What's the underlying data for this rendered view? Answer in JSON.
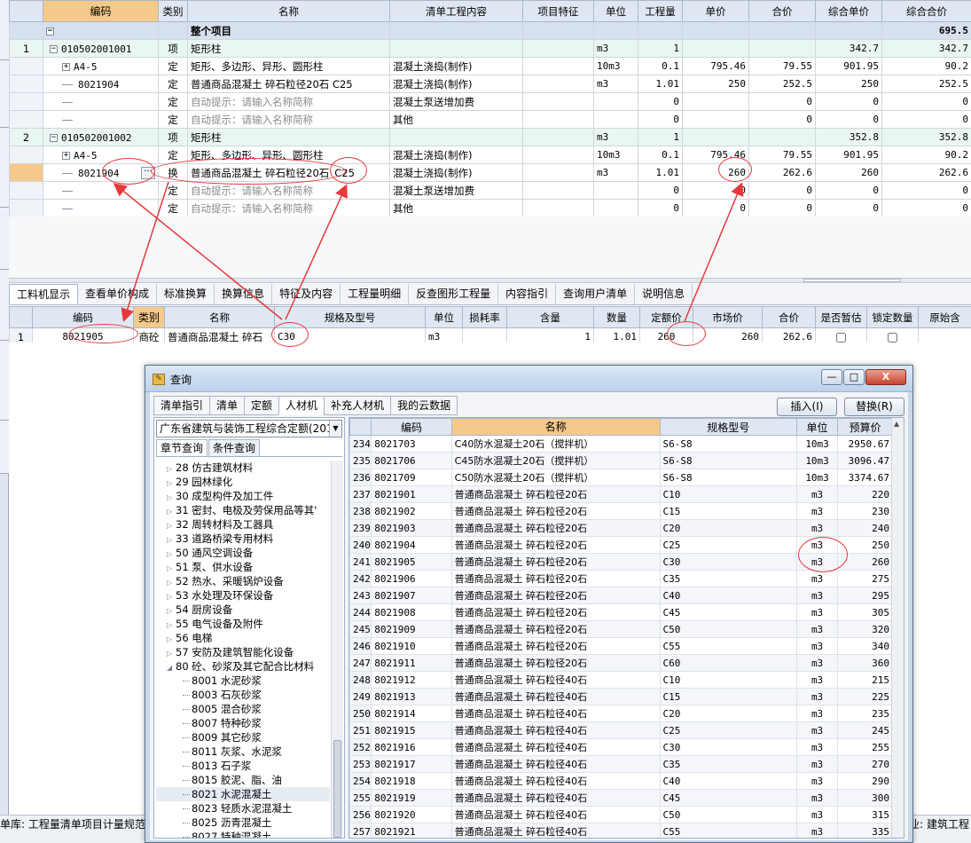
{
  "top_table": {
    "headers": [
      "",
      "编码",
      "类别",
      "名称",
      "清单工程内容",
      "项目特征",
      "单位",
      "工程量",
      "单价",
      "合价",
      "综合单价",
      "综合合价"
    ],
    "project_row": {
      "toggle": "−",
      "name": "整个项目",
      "total": "695.5"
    },
    "rows": [
      {
        "rn": "1",
        "level": "list",
        "toggle": "−",
        "code": "010502001001",
        "type": "项",
        "name": "矩形柱",
        "content": "",
        "feature": "",
        "unit": "m3",
        "qty": "1",
        "price": "",
        "amount": "",
        "comp_price": "342.7",
        "comp_amount": "342.7"
      },
      {
        "rn": "",
        "level": "quota",
        "toggle": "+",
        "code": "A4-5",
        "type": "定",
        "name": "矩形、多边形、异形、圆形柱",
        "content": "混凝土浇捣(制作)",
        "feature": "",
        "unit": "10m3",
        "qty": "0.1",
        "price": "795.46",
        "amount": "79.55",
        "comp_price": "901.95",
        "comp_amount": "90.2"
      },
      {
        "rn": "",
        "level": "item",
        "toggle": "",
        "code": "8021904",
        "type": "定",
        "name": "普通商品混凝土 碎石粒径20石 C25",
        "content": "混凝土浇捣(制作)",
        "feature": "",
        "unit": "m3",
        "qty": "1.01",
        "price": "250",
        "amount": "252.5",
        "comp_price": "250",
        "comp_amount": "252.5"
      },
      {
        "rn": "",
        "level": "item",
        "toggle": "",
        "code": "",
        "type": "定",
        "name": "自动提示：请输入名称简称",
        "content": "混凝土泵送增加费",
        "feature": "",
        "unit": "",
        "qty": "",
        "price": "",
        "amount": "0",
        "comp_price": "0",
        "comp_amount": "0",
        "qty_zero": "0",
        "gray": true
      },
      {
        "rn": "",
        "level": "item",
        "toggle": "",
        "code": "",
        "type": "定",
        "name": "自动提示：请输入名称简称",
        "content": "其他",
        "feature": "",
        "unit": "",
        "qty": "",
        "price": "",
        "amount": "0",
        "comp_price": "0",
        "comp_amount": "0",
        "qty_zero": "0",
        "gray": true
      },
      {
        "rn": "2",
        "level": "list",
        "toggle": "−",
        "code": "010502001002",
        "type": "项",
        "name": "矩形柱",
        "content": "",
        "feature": "",
        "unit": "m3",
        "qty": "1",
        "price": "",
        "amount": "",
        "comp_price": "352.8",
        "comp_amount": "352.8"
      },
      {
        "rn": "",
        "level": "quota",
        "toggle": "+",
        "code": "A4-5",
        "type": "定",
        "name": "矩形、多边形、异形、圆形柱",
        "content": "混凝土浇捣(制作)",
        "feature": "",
        "unit": "10m3",
        "qty": "0.1",
        "price": "795.46",
        "amount": "79.55",
        "comp_price": "901.95",
        "comp_amount": "90.2"
      },
      {
        "rn": "",
        "level": "cur",
        "toggle": "",
        "code": "8021904",
        "type": "换",
        "name": "普通商品混凝土 碎石粒径20石",
        "name_tail": "C25",
        "content": "混凝土浇捣(制作)",
        "feature": "",
        "unit": "m3",
        "qty": "1.01",
        "price": "260",
        "amount": "262.6",
        "comp_price": "260",
        "comp_amount": "262.6",
        "dots": "···"
      },
      {
        "rn": "",
        "level": "item",
        "toggle": "",
        "code": "",
        "type": "定",
        "name": "自动提示：请输入名称简称",
        "content": "混凝土泵送增加费",
        "feature": "",
        "unit": "",
        "qty": "",
        "price": "0",
        "amount": "0",
        "comp_price": "0",
        "comp_amount": "0",
        "qty_zero": "0",
        "gray": true
      },
      {
        "rn": "",
        "level": "item",
        "toggle": "",
        "code": "",
        "type": "定",
        "name": "自动提示：请输入名称简称",
        "content": "其他",
        "feature": "",
        "unit": "",
        "qty": "",
        "price": "0",
        "amount": "0",
        "comp_price": "0",
        "comp_amount": "0",
        "qty_zero": "0",
        "gray": true
      }
    ]
  },
  "mid_tabs": [
    "工料机显示",
    "查看单价构成",
    "标准换算",
    "换算信息",
    "特征及内容",
    "工程量明细",
    "反查图形工程量",
    "内容指引",
    "查询用户清单",
    "说明信息"
  ],
  "mid_table": {
    "headers": [
      "",
      "编码",
      "类别",
      "名称",
      "规格及型号",
      "单位",
      "损耗率",
      "含量",
      "数量",
      "定额价",
      "市场价",
      "合价",
      "是否暂估",
      "锁定数量",
      "原始含"
    ],
    "row": {
      "rn": "1",
      "code": "8021905",
      "type": "商砼",
      "name": "普通商品混凝土 碎石",
      "spec": "C30",
      "unit": "m3",
      "loss": "",
      "content": "1",
      "qty": "1.01",
      "quota_price": "260",
      "market_price": "260",
      "amount": "262.6"
    }
  },
  "dialog": {
    "title": "查询",
    "window_buttons": {
      "minimize": "—",
      "restore": "□",
      "close": "X"
    },
    "tabs": [
      "清单指引",
      "清单",
      "定额",
      "人材机",
      "补充人材机",
      "我的云数据"
    ],
    "active_tab": "人材机",
    "insert_label": "插入(I)",
    "replace_label": "替换(R)",
    "library": "广东省建筑与装饰工程综合定额(201",
    "subtabs": [
      "章节查询",
      "条件查询"
    ],
    "tree": [
      {
        "arrow": "▷",
        "label": "28 仿古建筑材料",
        "indent": 1
      },
      {
        "arrow": "▷",
        "label": "29 园林绿化",
        "indent": 1
      },
      {
        "arrow": "▷",
        "label": "30 成型构件及加工件",
        "indent": 1
      },
      {
        "arrow": "▷",
        "label": "31 密封、电极及劳保用品等其'",
        "indent": 1
      },
      {
        "arrow": "▷",
        "label": "32 周转材料及工器具",
        "indent": 1
      },
      {
        "arrow": "▷",
        "label": "33 道路桥梁专用材料",
        "indent": 1
      },
      {
        "arrow": "▷",
        "label": "50 通风空调设备",
        "indent": 1
      },
      {
        "arrow": "▷",
        "label": "51 泵、供水设备",
        "indent": 1
      },
      {
        "arrow": "▷",
        "label": "52 热水、采暖锅炉设备",
        "indent": 1
      },
      {
        "arrow": "▷",
        "label": "53 水处理及环保设备",
        "indent": 1
      },
      {
        "arrow": "▷",
        "label": "54 厨房设备",
        "indent": 1
      },
      {
        "arrow": "▷",
        "label": "55 电气设备及附件",
        "indent": 1
      },
      {
        "arrow": "▷",
        "label": "56 电梯",
        "indent": 1
      },
      {
        "arrow": "▷",
        "label": "57 安防及建筑智能化设备",
        "indent": 1
      },
      {
        "arrow": "◢",
        "label": "80 砼、砂浆及其它配合比材料",
        "indent": 1
      },
      {
        "arrow": "",
        "label": "8001 水泥砂浆",
        "indent": 2
      },
      {
        "arrow": "",
        "label": "8003 石灰砂浆",
        "indent": 2
      },
      {
        "arrow": "",
        "label": "8005 混合砂浆",
        "indent": 2
      },
      {
        "arrow": "",
        "label": "8007 特种砂浆",
        "indent": 2
      },
      {
        "arrow": "",
        "label": "8009 其它砂浆",
        "indent": 2
      },
      {
        "arrow": "",
        "label": "8011 灰浆、水泥浆",
        "indent": 2
      },
      {
        "arrow": "",
        "label": "8013 石子浆",
        "indent": 2
      },
      {
        "arrow": "",
        "label": "8015 胶泥、脂、油",
        "indent": 2
      },
      {
        "arrow": "",
        "label": "8021 水泥混凝土",
        "indent": 2,
        "selected": true
      },
      {
        "arrow": "",
        "label": "8023 轻质水泥混凝土",
        "indent": 2
      },
      {
        "arrow": "",
        "label": "8025 沥青混凝土",
        "indent": 2
      },
      {
        "arrow": "",
        "label": "8027 特种混凝土",
        "indent": 2
      }
    ],
    "headers": [
      "",
      "编码",
      "名称",
      "规格型号",
      "单位",
      "预算价"
    ],
    "rows": [
      [
        "234",
        "8021703",
        "C40防水混凝土20石（搅拌机）",
        "S6-S8",
        "10m3",
        "2950.67"
      ],
      [
        "235",
        "8021706",
        "C45防水混凝土20石（搅拌机）",
        "S6-S8",
        "10m3",
        "3096.47"
      ],
      [
        "236",
        "8021709",
        "C50防水混凝土20石（搅拌机）",
        "S6-S8",
        "10m3",
        "3374.67"
      ],
      [
        "237",
        "8021901",
        "普通商品混凝土 碎石粒径20石",
        "C10",
        "m3",
        "220"
      ],
      [
        "238",
        "8021902",
        "普通商品混凝土 碎石粒径20石",
        "C15",
        "m3",
        "230"
      ],
      [
        "239",
        "8021903",
        "普通商品混凝土 碎石粒径20石",
        "C20",
        "m3",
        "240"
      ],
      [
        "240",
        "8021904",
        "普通商品混凝土 碎石粒径20石",
        "C25",
        "m3",
        "250"
      ],
      [
        "241",
        "8021905",
        "普通商品混凝土 碎石粒径20石",
        "C30",
        "m3",
        "260"
      ],
      [
        "242",
        "8021906",
        "普通商品混凝土 碎石粒径20石",
        "C35",
        "m3",
        "275"
      ],
      [
        "243",
        "8021907",
        "普通商品混凝土 碎石粒径20石",
        "C40",
        "m3",
        "295"
      ],
      [
        "244",
        "8021908",
        "普通商品混凝土 碎石粒径20石",
        "C45",
        "m3",
        "305"
      ],
      [
        "245",
        "8021909",
        "普通商品混凝土 碎石粒径20石",
        "C50",
        "m3",
        "320"
      ],
      [
        "246",
        "8021910",
        "普通商品混凝土 碎石粒径20石",
        "C55",
        "m3",
        "340"
      ],
      [
        "247",
        "8021911",
        "普通商品混凝土 碎石粒径20石",
        "C60",
        "m3",
        "360"
      ],
      [
        "248",
        "8021912",
        "普通商品混凝土 碎石粒径40石",
        "C10",
        "m3",
        "215"
      ],
      [
        "249",
        "8021913",
        "普通商品混凝土 碎石粒径40石",
        "C15",
        "m3",
        "225"
      ],
      [
        "250",
        "8021914",
        "普通商品混凝土 碎石粒径40石",
        "C20",
        "m3",
        "235"
      ],
      [
        "251",
        "8021915",
        "普通商品混凝土 碎石粒径40石",
        "C25",
        "m3",
        "245"
      ],
      [
        "252",
        "8021916",
        "普通商品混凝土 碎石粒径40石",
        "C30",
        "m3",
        "255"
      ],
      [
        "253",
        "8021917",
        "普通商品混凝土 碎石粒径40石",
        "C35",
        "m3",
        "270"
      ],
      [
        "254",
        "8021918",
        "普通商品混凝土 碎石粒径40石",
        "C40",
        "m3",
        "290"
      ],
      [
        "255",
        "8021919",
        "普通商品混凝土 碎石粒径40石",
        "C45",
        "m3",
        "300"
      ],
      [
        "256",
        "8021920",
        "普通商品混凝土 碎石粒径40石",
        "C50",
        "m3",
        "315"
      ],
      [
        "257",
        "8021921",
        "普通商品混凝土 碎石粒径40石",
        "C55",
        "m3",
        "335"
      ]
    ]
  },
  "status": {
    "left": "单库: 工程量清单项目计量规范",
    "right": "专业: 建筑工程"
  },
  "colors": {
    "annotation": "#e8383a",
    "header": "#dfe7f3",
    "selected": "#f5c98a",
    "list_row": "#eaf6f2"
  }
}
